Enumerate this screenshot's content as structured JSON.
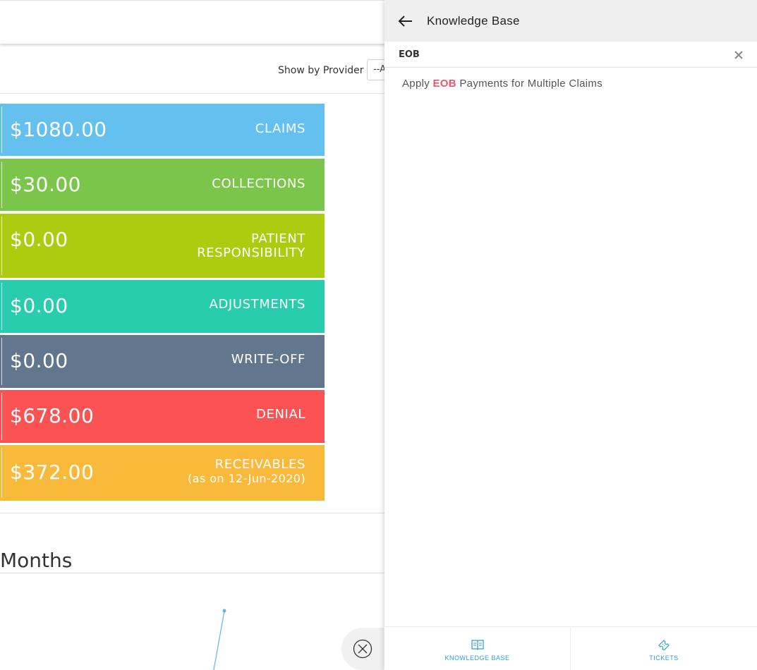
{
  "filter": {
    "label": "Show by Provider",
    "selected": "--A"
  },
  "tiles": {
    "claims": {
      "amount": "$1080.00",
      "label": "CLAIMS",
      "color": "#64c1ef"
    },
    "collections": {
      "amount": "$30.00",
      "label": "COLLECTIONS",
      "color": "#7bc54b"
    },
    "patient_responsibility": {
      "amount": "$0.00",
      "label_line1": "PATIENT",
      "label_line2": "RESPONSIBILITY",
      "color": "#adcc0f"
    },
    "adjustments": {
      "amount": "$0.00",
      "label": "ADJUSTMENTS",
      "color": "#28cdad"
    },
    "write_off": {
      "amount": "$0.00",
      "label": "WRITE-OFF",
      "color": "#62778e"
    },
    "denial": {
      "amount": "$678.00",
      "label": "DENIAL",
      "color": "#fb5354"
    },
    "receivables": {
      "amount": "$372.00",
      "label": "RECEIVABLES",
      "sublabel": "(as on 12-Jun-2020)",
      "color": "#f9ba3b"
    }
  },
  "months_section": {
    "title": "Months"
  },
  "knowledge_base": {
    "title": "Knowledge Base",
    "search_value": "EOB",
    "results": [
      {
        "prefix": "Apply",
        "highlight": "EOB",
        "suffix": "Payments for Multiple Claims"
      }
    ],
    "highlight_color": "#e8576e",
    "footer_tabs": [
      {
        "label": "KNOWLEDGE BASE",
        "icon": "book-icon"
      },
      {
        "label": "TICKETS",
        "icon": "ticket-icon"
      }
    ],
    "accent_color": "#2b9ed6"
  }
}
